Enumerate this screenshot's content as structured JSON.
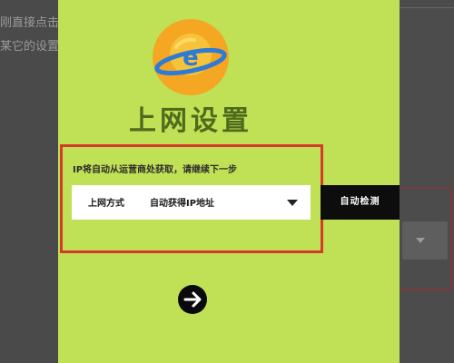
{
  "background": {
    "line1": "刚直接点击",
    "line2": "某它的设置"
  },
  "panel": {
    "title": "上网设置",
    "hint": "IP将自动从运营商处获取，请继续下一步",
    "connection": {
      "label": "上网方式",
      "value": "自动获得IP地址"
    },
    "detect_button": "自动检测",
    "next_icon": "arrow-right-icon",
    "logo_icon": "globe-e-icon"
  },
  "colors": {
    "panel_bg": "#c0e155",
    "title": "#4f6a1d",
    "highlight_frame": "#d63a2a",
    "logo_orange": "#f5a623",
    "logo_blue": "#2e7bd6"
  }
}
